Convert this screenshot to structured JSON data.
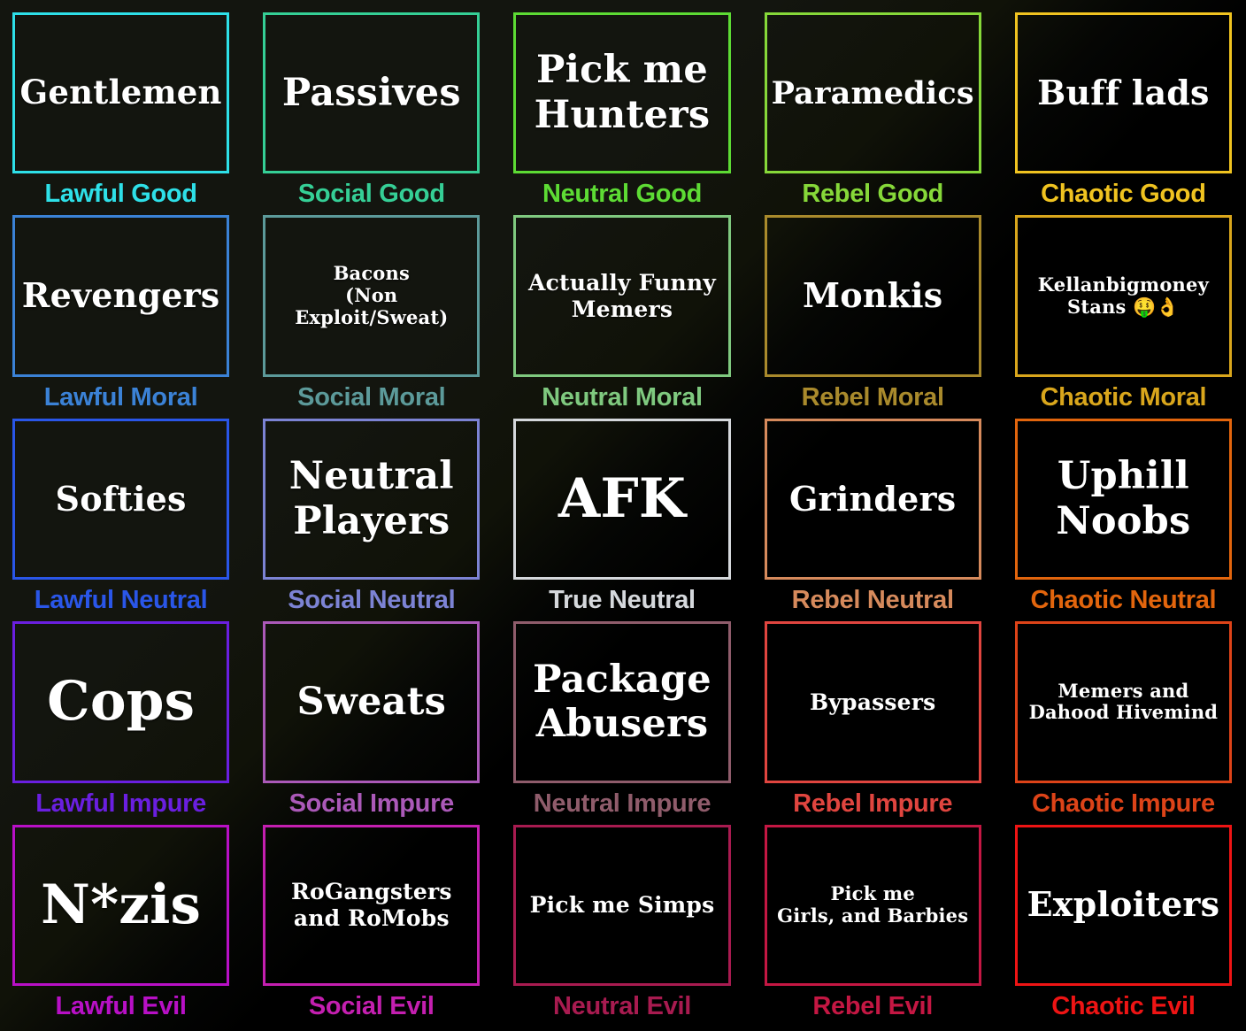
{
  "meta": {
    "title": "Da Hood Player Alignment Chart",
    "columns": 5,
    "rows": 5,
    "background_color": "#000000",
    "entry_text_color": "#ffffff"
  },
  "cells": [
    {
      "entry": "Gentlemen",
      "alignment": "Lawful Good",
      "color": "#2ee0e8",
      "size": "lg"
    },
    {
      "entry": "Passives",
      "alignment": "Social Good",
      "color": "#35cf96",
      "size": "lg"
    },
    {
      "entry": "Pick me\nHunters",
      "alignment": "Neutral Good",
      "color": "#5ddb34",
      "size": "lg"
    },
    {
      "entry": "Paramedics",
      "alignment": "Rebel Good",
      "color": "#86d839",
      "size": "md"
    },
    {
      "entry": "Buff lads",
      "alignment": "Chaotic Good",
      "color": "#f0c320",
      "size": "md"
    },
    {
      "entry": "Revengers",
      "alignment": "Lawful Moral",
      "color": "#3b82d6",
      "size": "md"
    },
    {
      "entry": "Bacons\n(Non Exploit/Sweat)",
      "alignment": "Social Moral",
      "color": "#5c9a9a",
      "size": "xs"
    },
    {
      "entry": "Actually Funny\nMemers",
      "alignment": "Neutral Moral",
      "color": "#7fc97f",
      "size": "sm"
    },
    {
      "entry": "Monkis",
      "alignment": "Rebel Moral",
      "color": "#a98a2c",
      "size": "md"
    },
    {
      "entry": "Kellanbigmoney\nStans 🤑👌",
      "alignment": "Chaotic Moral",
      "color": "#d9a61c",
      "size": "xs"
    },
    {
      "entry": "Softies",
      "alignment": "Lawful Neutral",
      "color": "#2a56e8",
      "size": "md"
    },
    {
      "entry": "Neutral\nPlayers",
      "alignment": "Social Neutral",
      "color": "#7c83d4",
      "size": "lg"
    },
    {
      "entry": "AFK",
      "alignment": "True Neutral",
      "color": "#d5d8dc",
      "size": "xl"
    },
    {
      "entry": "Grinders",
      "alignment": "Rebel Neutral",
      "color": "#d68a5c",
      "size": "md"
    },
    {
      "entry": "Uphill\nNoobs",
      "alignment": "Chaotic Neutral",
      "color": "#e2650d",
      "size": "lg"
    },
    {
      "entry": "Cops",
      "alignment": "Lawful Impure",
      "color": "#6a1fe0",
      "size": "xl"
    },
    {
      "entry": "Sweats",
      "alignment": "Social Impure",
      "color": "#ab59b8",
      "size": "lg"
    },
    {
      "entry": "Package\nAbusers",
      "alignment": "Neutral Impure",
      "color": "#8f5c6b",
      "size": "lg"
    },
    {
      "entry": "Bypassers",
      "alignment": "Rebel Impure",
      "color": "#e0453f",
      "size": "sm"
    },
    {
      "entry": "Memers and\nDahood Hivemind",
      "alignment": "Chaotic Impure",
      "color": "#dd4318",
      "size": "xs"
    },
    {
      "entry": "N*zis",
      "alignment": "Lawful Evil",
      "color": "#b810c6",
      "size": "xl"
    },
    {
      "entry": "RoGangsters\nand RoMobs",
      "alignment": "Social Evil",
      "color": "#c41fb0",
      "size": "sm"
    },
    {
      "entry": "Pick me Simps",
      "alignment": "Neutral Evil",
      "color": "#a81b50",
      "size": "sm"
    },
    {
      "entry": "Pick me\nGirls, and Barbies",
      "alignment": "Rebel Evil",
      "color": "#c41743",
      "size": "xs"
    },
    {
      "entry": "Exploiters",
      "alignment": "Chaotic Evil",
      "color": "#ee1414",
      "size": "md"
    }
  ]
}
